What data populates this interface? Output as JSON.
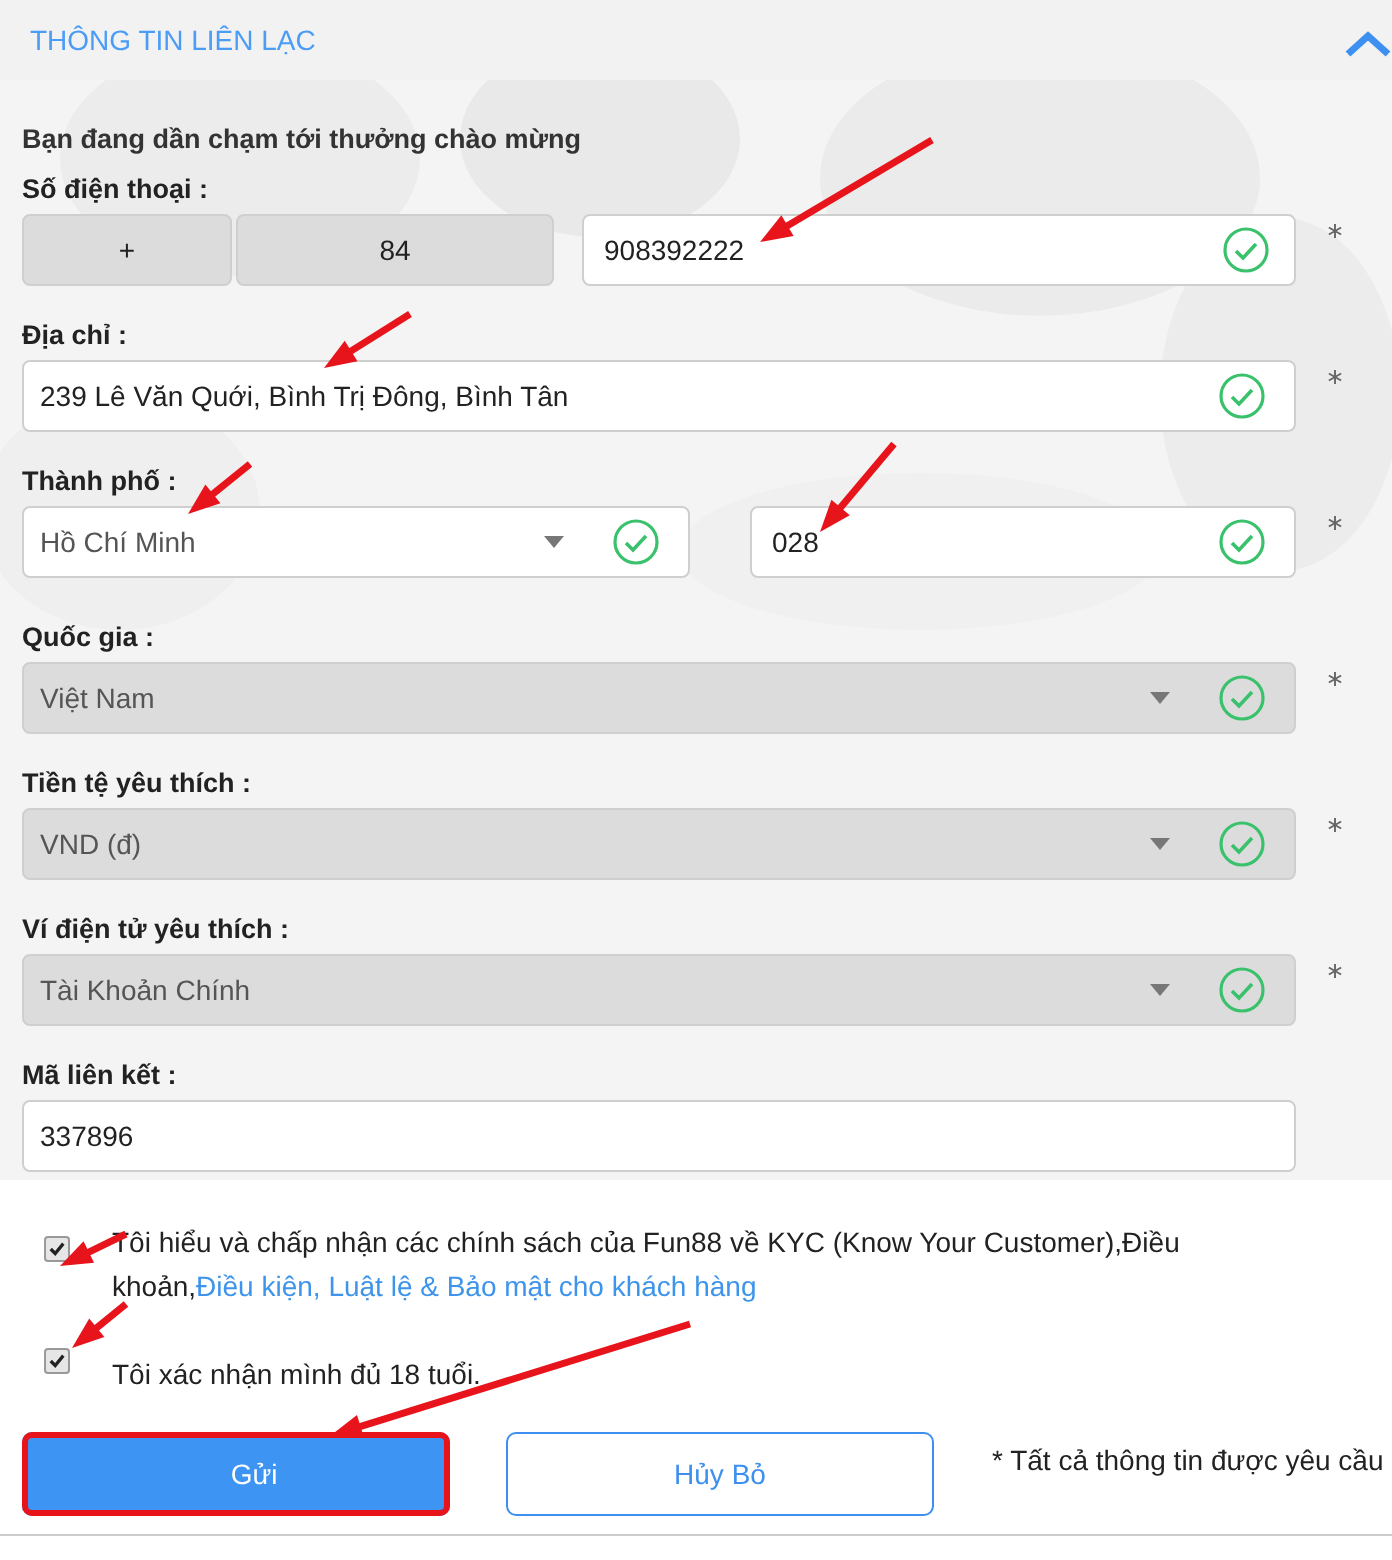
{
  "section": {
    "title": "THÔNG TIN LIÊN LẠC",
    "expanded": true
  },
  "intro": "Bạn đang dần chạm tới thưởng chào mừng",
  "fields": [
    {
      "label": "Số điện thoại :",
      "kind": "phone",
      "prefix": "+",
      "code": "84",
      "value": "908392222",
      "valid": true,
      "required": true
    },
    {
      "label": "Địa chỉ :",
      "kind": "text",
      "value": "239 Lê Văn Quới, Bình Trị Đông, Bình Tân",
      "valid": true,
      "required": true,
      "disabled": false
    },
    {
      "label": "Thành phố :",
      "kind": "city",
      "value": "Hồ Chí Minh",
      "area_code": "028",
      "valid": true,
      "required": true
    },
    {
      "label": "Quốc gia :",
      "kind": "select",
      "value": "Việt Nam",
      "valid": true,
      "required": true,
      "disabled": true
    },
    {
      "label": "Tiền tệ yêu thích :",
      "kind": "select",
      "value": "VND (đ)",
      "valid": true,
      "required": true,
      "disabled": true
    },
    {
      "label": "Ví điện tử yêu thích :",
      "kind": "select",
      "value": "Tài Khoản Chính",
      "valid": true,
      "required": true,
      "disabled": true
    },
    {
      "label": "Mã liên kết :",
      "kind": "text",
      "value": "337896",
      "valid": false,
      "required": false,
      "disabled": false
    }
  ],
  "consents": [
    {
      "text": "Tôi hiểu và chấp nhận các chính sách của Fun88 về KYC (Know Your Customer),Điều khoản,",
      "link": "Điều kiện, Luật lệ & Bảo mật cho khách hàng",
      "checked": true
    },
    {
      "text": "Tôi xác nhận mình đủ 18 tuổi.",
      "checked": true
    }
  ],
  "buttons": [
    {
      "label": "Gửi",
      "primary": true,
      "highlighted": true
    },
    {
      "label": "Hủy Bỏ",
      "primary": false,
      "highlighted": false
    }
  ],
  "required_note": "* Tất cả thông tin được yêu cầu"
}
